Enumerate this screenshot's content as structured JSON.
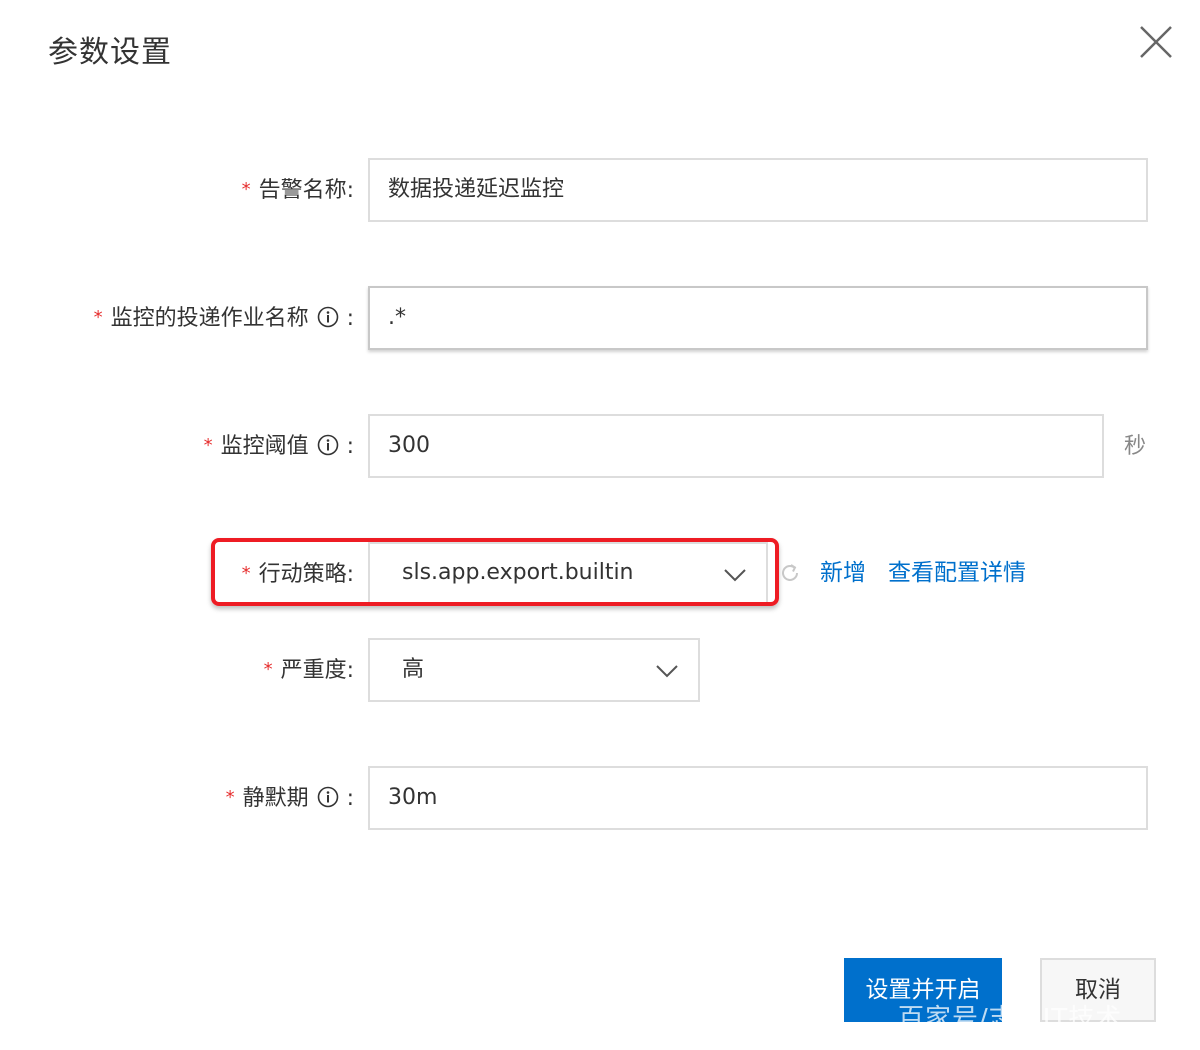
{
  "dialog": {
    "title": "参数设置",
    "close_icon": "close-icon"
  },
  "form": {
    "required_mark": "*",
    "alert_name": {
      "label": "告警名称:",
      "value": "数据投递延迟监控"
    },
    "job_name": {
      "label": "监控的投递作业名称",
      "colon": ":",
      "icon": "info-icon",
      "value": ".*"
    },
    "threshold": {
      "label": "监控阈值",
      "colon": ":",
      "icon": "info-icon",
      "value": "300",
      "unit": "秒"
    },
    "action_policy": {
      "label": "行动策略:",
      "value": "sls.app.export.builtin",
      "icon": "chevron-down-icon",
      "refresh_icon": "refresh-icon",
      "add_link": "新增",
      "details_link": "查看配置详情",
      "highlight_color": "#ee1c24"
    },
    "severity": {
      "label": "严重度:",
      "value": "高",
      "icon": "chevron-down-icon"
    },
    "silence_period": {
      "label": "静默期",
      "colon": ":",
      "icon": "info-icon",
      "value": "30m"
    }
  },
  "footer": {
    "confirm_label": "设置并开启",
    "cancel_label": "取消"
  },
  "watermark": "百家号/志东IT技术",
  "colors": {
    "primary": "#0070cc",
    "required": "#e62e2e",
    "border": "#dddddd",
    "highlight": "#ee1c24"
  }
}
